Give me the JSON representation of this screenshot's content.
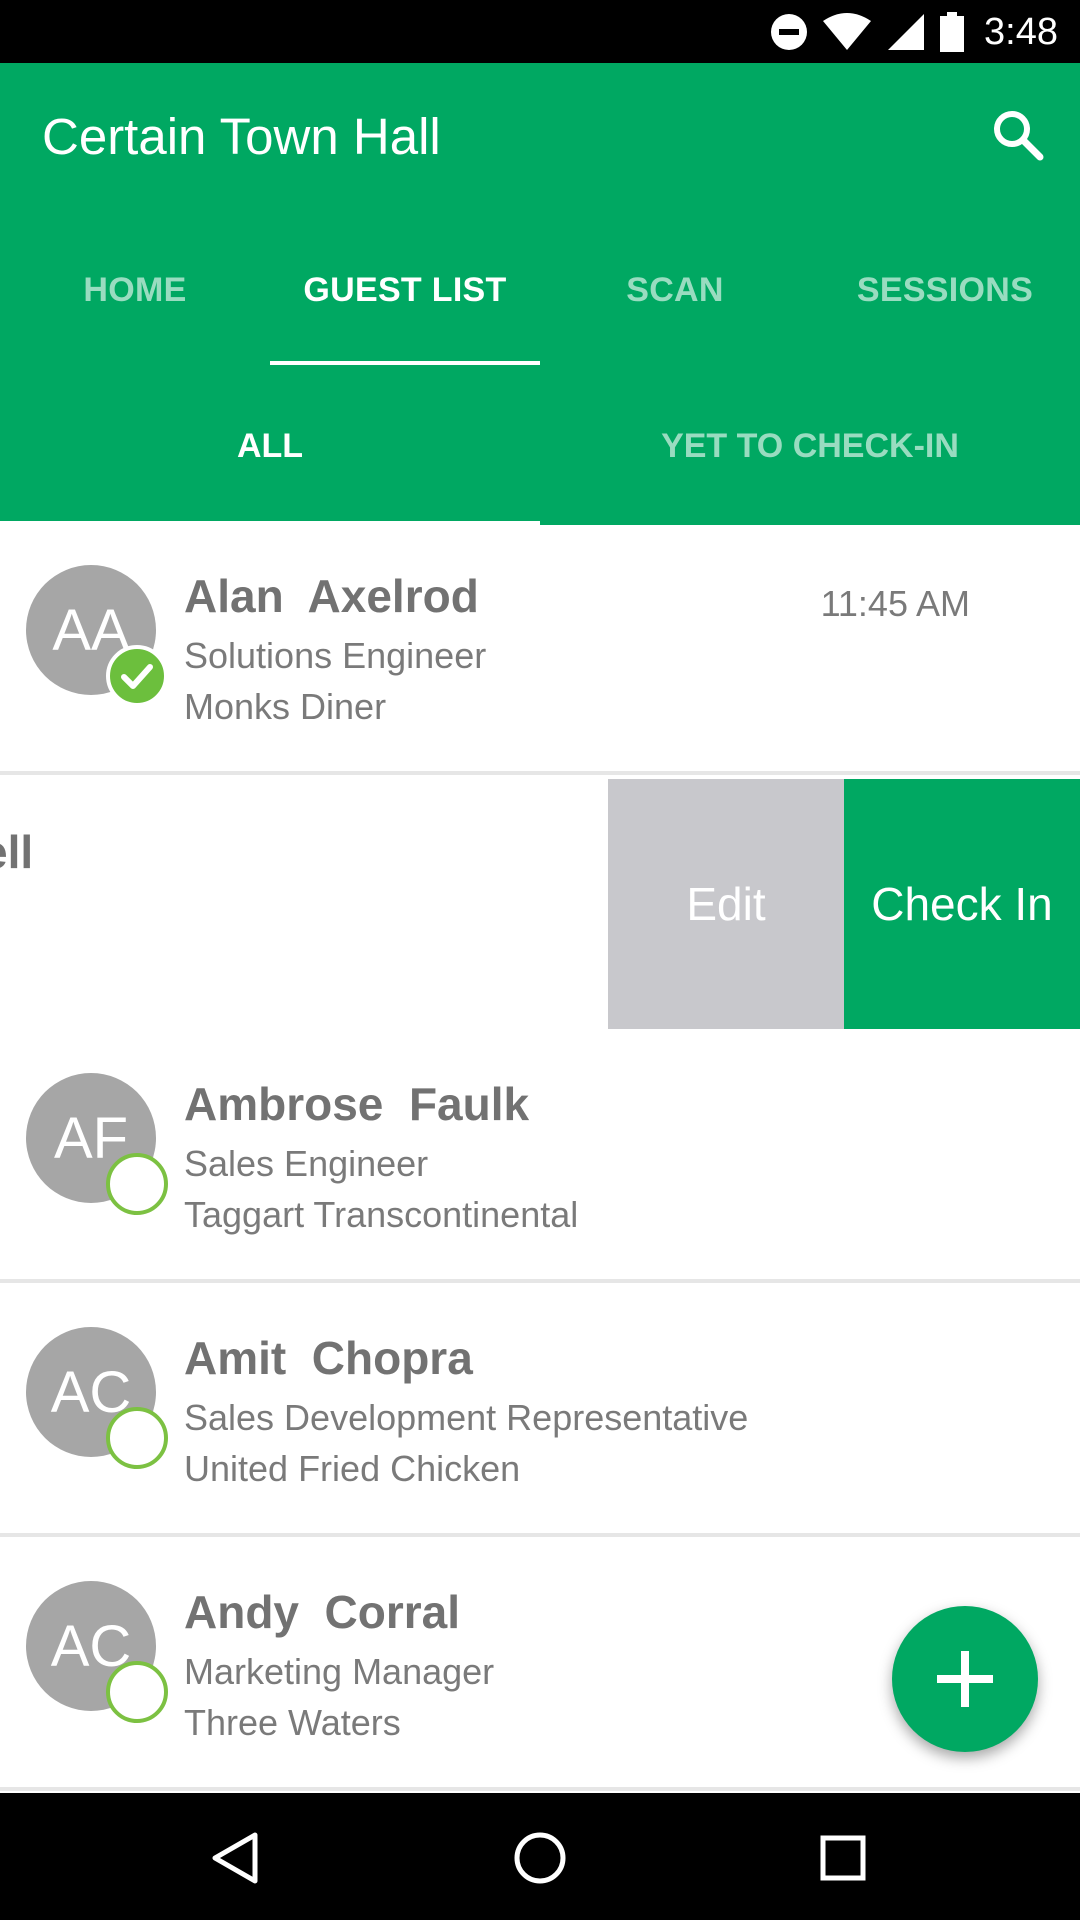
{
  "status_bar": {
    "time": "3:48",
    "icons": [
      "do-not-disturb-icon",
      "wifi-icon",
      "cell-signal-icon",
      "battery-icon"
    ]
  },
  "app_bar": {
    "title": "Certain Town Hall",
    "search_icon": "search-icon",
    "color": "#00a862"
  },
  "tabs": [
    {
      "label": "HOME",
      "active": false
    },
    {
      "label": "GUEST LIST",
      "active": true
    },
    {
      "label": "SCAN",
      "active": false
    },
    {
      "label": "SESSIONS",
      "active": false
    }
  ],
  "subtabs": [
    {
      "label": "ALL",
      "active": true
    },
    {
      "label": "YET TO CHECK-IN",
      "active": false
    }
  ],
  "guests": [
    {
      "initials": "AA",
      "name": "Alan  Axelrod",
      "title": "Solutions Engineer",
      "company": "Monks Diner",
      "time": "11:45 AM",
      "checked_in": true
    },
    {
      "initials": "AF",
      "name": "Ambrose  Faulk",
      "title": "Sales Engineer",
      "company": "Taggart Transcontinental",
      "checked_in": false
    },
    {
      "initials": "AC",
      "name": "Amit  Chopra",
      "title": "Sales Development Representative",
      "company": "United Fried Chicken",
      "checked_in": false
    },
    {
      "initials": "AC",
      "name": "Andy  Corral",
      "title": "Marketing Manager",
      "company": "Three Waters",
      "checked_in": false
    }
  ],
  "swiped_row": {
    "visible_name_fragment": "ell",
    "edit_label": "Edit",
    "check_in_label": "Check In",
    "edit_color": "#c8c8cc",
    "check_in_color": "#00a862"
  },
  "fab": {
    "icon": "plus-icon"
  },
  "nav_bar": {
    "icons": [
      "back-icon",
      "home-icon",
      "recents-icon"
    ]
  }
}
